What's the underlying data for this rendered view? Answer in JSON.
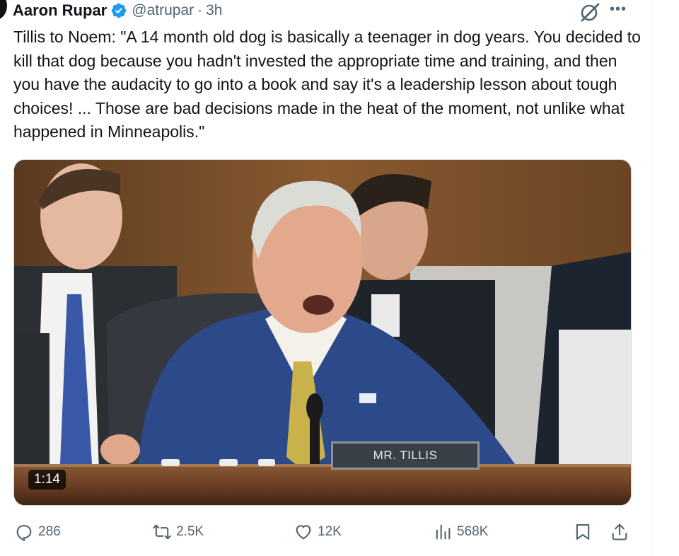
{
  "author": {
    "name": "Aaron Rupar",
    "handle": "@atrupar",
    "separator": "·",
    "time": "3h"
  },
  "tweet": {
    "text": "Tillis to Noem: \"A 14 month old dog is basically a teenager in dog years. You decided to kill that dog because you hadn't invested the appropriate time and training, and then you have the audacity to go into a book and say it's a leadership lesson about tough choices! ... Those are bad decisions made in the heat of the moment, not unlike what happened in Minneapolis.\""
  },
  "media": {
    "duration": "1:14",
    "nameplate": "MR. TILLIS"
  },
  "actions": {
    "replies": "286",
    "reposts": "2.5K",
    "likes": "12K",
    "views": "568K"
  },
  "icons": {
    "verified": "verified-badge-icon",
    "grok": "grok-icon",
    "more": "more-icon",
    "reply": "reply-icon",
    "repost": "repost-icon",
    "like": "heart-icon",
    "views": "views-icon",
    "bookmark": "bookmark-icon",
    "share": "share-icon"
  },
  "colors": {
    "verified": "#1d9bf0",
    "text": "#0f1419",
    "secondary": "#536471"
  }
}
